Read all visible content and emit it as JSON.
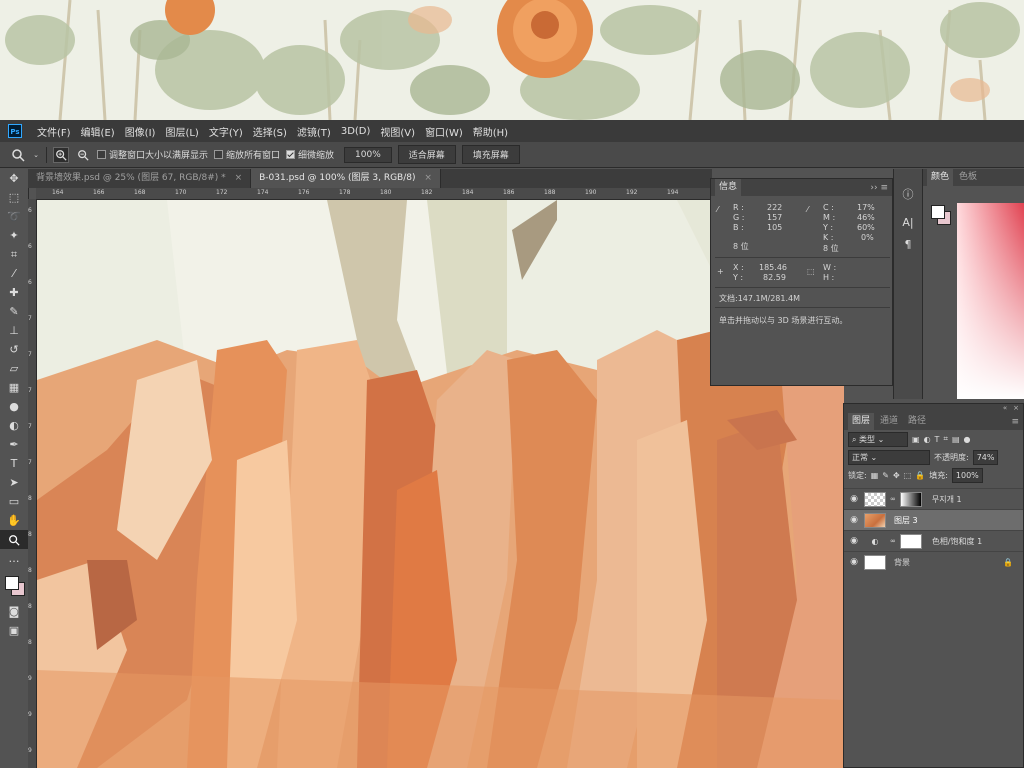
{
  "app": {
    "logo_text": "Ps"
  },
  "menu": [
    "文件(F)",
    "编辑(E)",
    "图像(I)",
    "图层(L)",
    "文字(Y)",
    "选择(S)",
    "滤镜(T)",
    "3D(D)",
    "视图(V)",
    "窗口(W)",
    "帮助(H)"
  ],
  "options": {
    "resize_window_label": "调整窗口大小以满屏显示",
    "zoom_all_label": "缩放所有窗口",
    "scrubby_zoom_label": "细微缩放",
    "zoom_value": "100%",
    "fit_screen_label": "适合屏幕",
    "fill_screen_label": "填充屏幕"
  },
  "tabs": [
    {
      "label": "背景墙效果.psd @ 25% (图层 67, RGB/8#) *",
      "close": "×"
    },
    {
      "label": "B-031.psd @ 100% (图层 3, RGB/8)",
      "close": "×"
    }
  ],
  "ruler": {
    "top": [
      "164",
      "166",
      "168",
      "170",
      "172",
      "174",
      "176",
      "178",
      "180",
      "182",
      "184",
      "186",
      "188",
      "190",
      "192",
      "194"
    ],
    "left": [
      "6",
      "6",
      "6",
      "7",
      "7",
      "7",
      "7",
      "7",
      "8",
      "8",
      "8",
      "8",
      "8",
      "9",
      "9",
      "9"
    ]
  },
  "info_panel": {
    "tab": "信息",
    "r_label": "R :",
    "r_value": "222",
    "g_label": "G :",
    "g_value": "157",
    "b_label": "B :",
    "b_value": "105",
    "bit_left": "8 位",
    "c_label": "C :",
    "c_value": "17%",
    "m_label": "M :",
    "m_value": "46%",
    "y_label": "Y :",
    "y_value": "60%",
    "k_label": "K :",
    "k_value": "0%",
    "bit_right": "8 位",
    "x_label": "X :",
    "x_value": "185.46",
    "y2_label": "Y :",
    "y2_value": "82.59",
    "w_label": "W :",
    "h_label": "H :",
    "doc_size": "文档:147.1M/281.4M",
    "hint": "单击并拖动以与 3D 场景进行互动。"
  },
  "color_panel": {
    "tab_color": "颜色",
    "tab_swatches": "色板"
  },
  "layers_panel": {
    "tab_layers": "图层",
    "tab_channels": "通道",
    "tab_paths": "路径",
    "filter_kind": "类型",
    "blend_mode": "正常",
    "opacity_label": "不透明度:",
    "opacity_value": "74%",
    "lock_label": "锁定:",
    "fill_label": "填充:",
    "fill_value": "100%",
    "layers": [
      {
        "name": "무지개 1",
        "selected": false
      },
      {
        "name": "图层 3",
        "selected": true
      },
      {
        "name": "色相/饱和度 1",
        "selected": false
      },
      {
        "name": "背景",
        "selected": false
      }
    ]
  },
  "colors": {
    "accent": "#31a8ff",
    "ui_dark": "#3a3a3a",
    "ui_mid": "#535353",
    "foreground_swatch": "#ffffff",
    "background_swatch": "#e8c7cf",
    "sampled_color": "#de9d69"
  }
}
